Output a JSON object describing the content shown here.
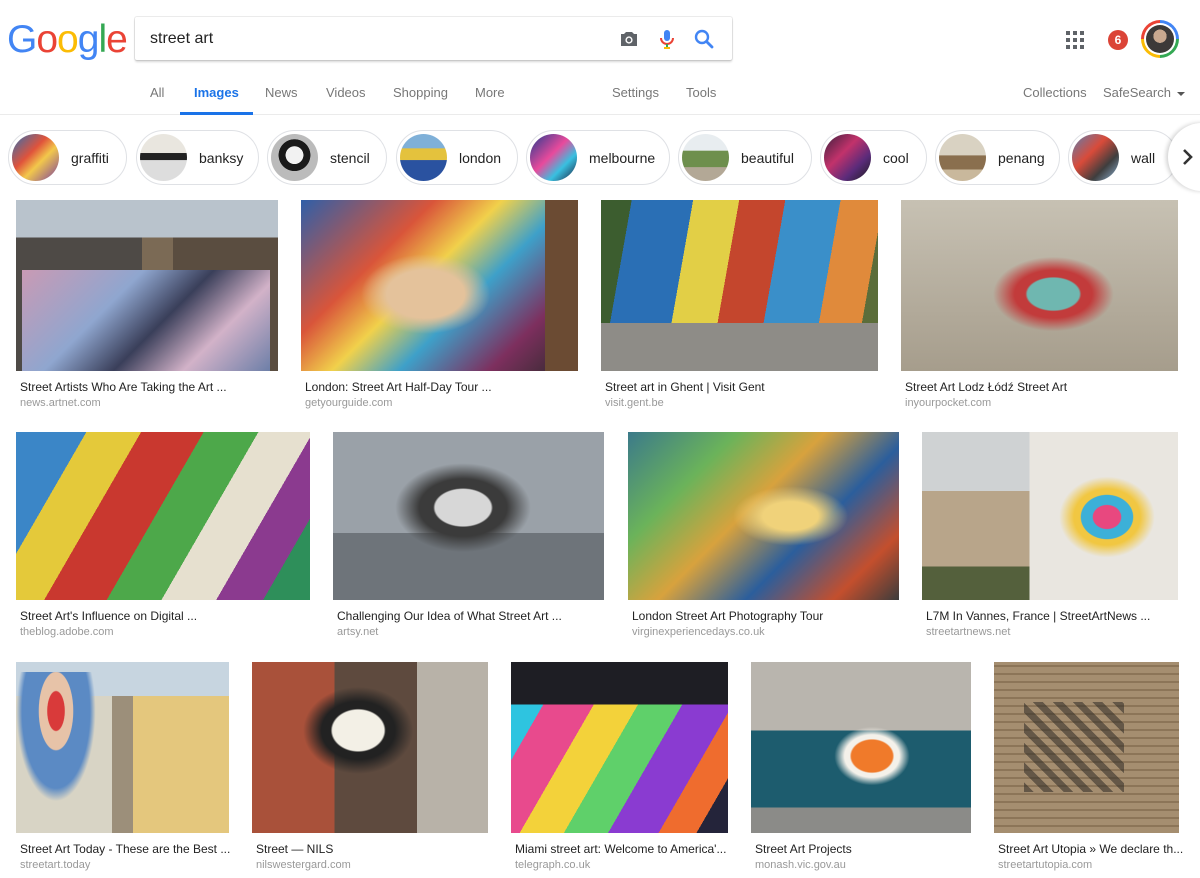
{
  "logo": {
    "letters": [
      "G",
      "o",
      "o",
      "g",
      "l",
      "e"
    ],
    "colors": [
      "#4285f4",
      "#ea4335",
      "#fbbc05",
      "#4285f4",
      "#34a853",
      "#ea4335"
    ]
  },
  "search": {
    "value": "street art",
    "placeholder": ""
  },
  "header": {
    "notification_count": "6"
  },
  "tabs": {
    "all": "All",
    "images": "Images",
    "news": "News",
    "videos": "Videos",
    "shopping": "Shopping",
    "more": "More",
    "settings": "Settings",
    "tools": "Tools",
    "collections": "Collections",
    "safesearch": "SafeSearch"
  },
  "chips": [
    {
      "label": "graffiti"
    },
    {
      "label": "banksy"
    },
    {
      "label": "stencil"
    },
    {
      "label": "london"
    },
    {
      "label": "melbourne"
    },
    {
      "label": "beautiful"
    },
    {
      "label": "cool"
    },
    {
      "label": "penang"
    },
    {
      "label": "wall"
    }
  ],
  "results": [
    {
      "title": "Street Artists Who Are Taking the Art ...",
      "source": "news.artnet.com"
    },
    {
      "title": "London: Street Art Half-Day Tour ...",
      "source": "getyourguide.com"
    },
    {
      "title": "Street art in Ghent | Visit Gent",
      "source": "visit.gent.be"
    },
    {
      "title": "Street Art Lodz Łódź Street Art",
      "source": "inyourpocket.com"
    },
    {
      "title": "Street Art's Influence on Digital ...",
      "source": "theblog.adobe.com"
    },
    {
      "title": "Challenging Our Idea of What Street Art ...",
      "source": "artsy.net"
    },
    {
      "title": "London Street Art Photography Tour",
      "source": "virginexperiencedays.co.uk"
    },
    {
      "title": "L7M In Vannes, France | StreetArtNews ...",
      "source": "streetartnews.net"
    },
    {
      "title": "Street Art Today - These are the Best ...",
      "source": "streetart.today"
    },
    {
      "title": "Street — NILS",
      "source": "nilswestergard.com"
    },
    {
      "title": "Miami street art: Welcome to America'...",
      "source": "telegraph.co.uk"
    },
    {
      "title": "Street Art Projects",
      "source": "monash.vic.gov.au"
    },
    {
      "title": "Street Art Utopia » We declare th...",
      "source": "streetartutopia.com"
    }
  ]
}
